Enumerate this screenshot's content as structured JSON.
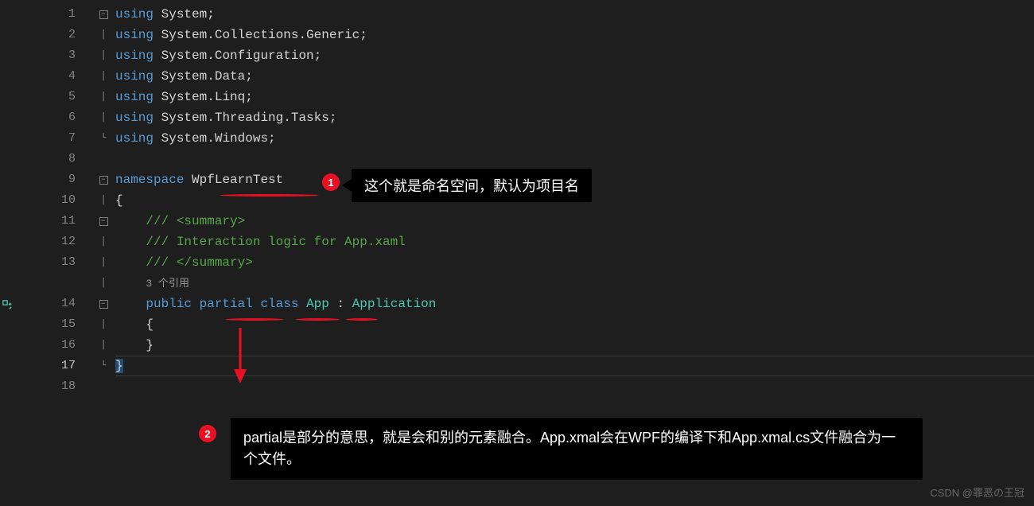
{
  "gutter": {
    "lines": [
      "1",
      "2",
      "3",
      "4",
      "5",
      "6",
      "7",
      "8",
      "9",
      "10",
      "11",
      "12",
      "13",
      "",
      "14",
      "15",
      "16",
      "17",
      "18"
    ],
    "current": 17
  },
  "folds": [
    {
      "line": 1,
      "type": "minus"
    },
    {
      "line": 9,
      "type": "minus"
    },
    {
      "line": 11,
      "type": "minus"
    },
    {
      "line": 14,
      "type": "minus"
    }
  ],
  "code": {
    "l1": {
      "kw": "using",
      "ns": "System",
      "punct": ";"
    },
    "l2": {
      "kw": "using",
      "ns": "System.Collections.Generic",
      "punct": ";"
    },
    "l3": {
      "kw": "using",
      "ns": "System.Configuration",
      "punct": ";"
    },
    "l4": {
      "kw": "using",
      "ns": "System.Data",
      "punct": ";"
    },
    "l5": {
      "kw": "using",
      "ns": "System.Linq",
      "punct": ";"
    },
    "l6": {
      "kw": "using",
      "ns": "System.Threading.Tasks",
      "punct": ";"
    },
    "l7": {
      "kw": "using",
      "ns": "System.Windows",
      "punct": ";"
    },
    "l9": {
      "kw": "namespace",
      "name": "WpfLearnTest"
    },
    "l10": {
      "brace": "{"
    },
    "l11": {
      "comment": "/// ",
      "tag": "<summary>"
    },
    "l12": {
      "comment": "/// Interaction logic for App.xaml"
    },
    "l13": {
      "comment": "/// ",
      "tag": "</summary>"
    },
    "codelens": "3 个引用",
    "l14": {
      "kw1": "public",
      "kw2": "partial",
      "kw3": "class",
      "name": "App",
      "colon": " : ",
      "base": "Application"
    },
    "l15": {
      "brace": "{"
    },
    "l16": {
      "brace": "}"
    },
    "l17": {
      "brace": "}"
    }
  },
  "annotations": {
    "a1": {
      "num": "1",
      "text": "这个就是命名空间，默认为项目名"
    },
    "a2": {
      "num": "2",
      "text": "partial是部分的意思，就是会和别的元素融合。App.xmal会在WPF的编译下和App.xmal.cs文件融合为一个文件。"
    }
  },
  "watermark": "CSDN @罪恶の王冠"
}
